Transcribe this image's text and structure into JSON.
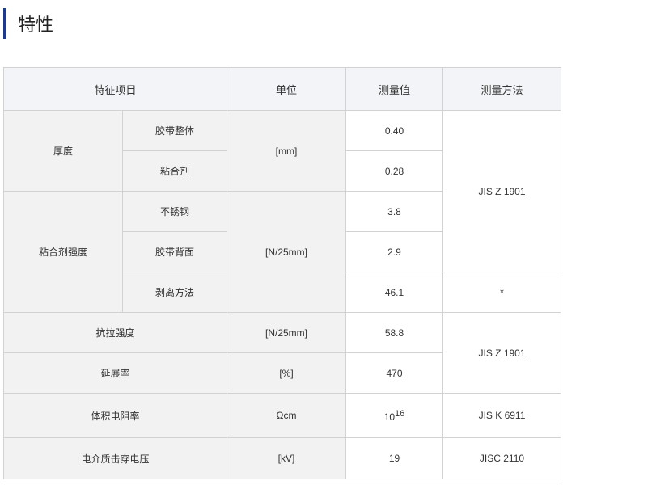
{
  "title": "特性",
  "table": {
    "headers": [
      "特征项目",
      "单位",
      "测量值",
      "测量方法"
    ],
    "rows": {
      "thickness": {
        "label": "厚度",
        "unit": "[mm]",
        "sub": [
          {
            "label": "胶带整体",
            "value": "0.40"
          },
          {
            "label": "粘合剂",
            "value": "0.28"
          }
        ]
      },
      "adhesion": {
        "label": "粘合剂强度",
        "unit": "[N/25mm]",
        "sub": [
          {
            "label": "不锈钢",
            "value": "3.8"
          },
          {
            "label": "胶带背面",
            "value": "2.9"
          },
          {
            "label": "剥离方法",
            "value": "46.1",
            "method": "*"
          }
        ]
      },
      "method_1": "JIS Z 1901",
      "tensile": {
        "label": "抗拉强度",
        "unit": "[N/25mm]",
        "value": "58.8"
      },
      "elongation": {
        "label": "延展率",
        "unit": "[%]",
        "value": "470"
      },
      "method_2": "JIS Z 1901",
      "resistivity": {
        "label": "体积电阻率",
        "unit": "Ωcm",
        "value_base": "10",
        "value_exp": "16",
        "method": "JIS K 6911"
      },
      "breakdown": {
        "label": "电介质击穿电压",
        "unit": "[kV]",
        "value": "19",
        "method": "JISC 2110"
      }
    }
  }
}
